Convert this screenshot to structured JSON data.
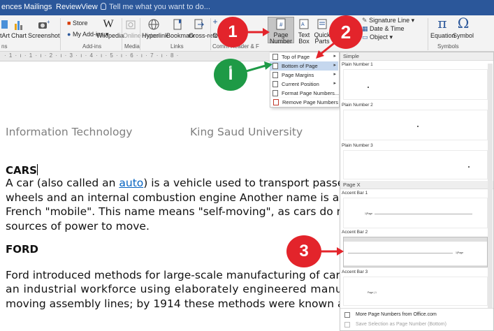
{
  "tabs": [
    {
      "label": "ences"
    },
    {
      "label": "Mailings"
    },
    {
      "label": "Review"
    },
    {
      "label": "View"
    }
  ],
  "tell_me": "Tell me what you want to do...",
  "ribbon": {
    "buttons": {
      "art": "tArt",
      "chart": "Chart",
      "screenshot": "Screenshot",
      "store": "Store",
      "my_addins": "My Add-ins",
      "wikipedia": "Wikipedia",
      "online_video": "Online Video",
      "hyperlink": "Hyperlink",
      "bookmark": "Bookmark",
      "cross_reference": "Cross-reference",
      "comment": "C",
      "page_number": "Page Number",
      "text_box": "Text Box",
      "quick_parts": "Quick Parts",
      "signature_line": "Signature Line",
      "date_time": "Date & Time",
      "object": "Object",
      "equation": "Equation",
      "symbol": "Symbol",
      "pi": "π",
      "omega": "Ω"
    },
    "groups": {
      "illustrations": "ns",
      "addins": "Add-ins",
      "media": "Media",
      "links": "Links",
      "comments": "Comm",
      "header_footer": "Header & F",
      "text": "t",
      "symbols": "Symbols"
    }
  },
  "ruler": "· 1 · ı · 1 · ı · 2 · ı · 3 · ı · 4 · ı · 5 · ı · 6 · ı · 7 · ı · 8 ·",
  "page_number_menu": {
    "items": [
      {
        "label": "Top of Page",
        "u": "T"
      },
      {
        "label": "Bottom of Page",
        "u": "B"
      },
      {
        "label": "Page Margins",
        "u": "P"
      },
      {
        "label": "Current Position",
        "u": "C"
      },
      {
        "label": "Format Page Numbers...",
        "u": "F"
      },
      {
        "label": "Remove Page Numbers",
        "u": "R"
      }
    ]
  },
  "gallery": {
    "section_simple": "Simple",
    "section_pagex": "Page X",
    "items": [
      {
        "title": "Plain Number 1"
      },
      {
        "title": "Plain Number 2"
      },
      {
        "title": "Plain Number 3"
      },
      {
        "title": "Accent Bar 1",
        "sample": "1|Page"
      },
      {
        "title": "Accent Bar 2",
        "sample": "1|Page"
      },
      {
        "title": "Accent Bar 3",
        "sample": "Page | 1"
      }
    ],
    "more": "More Page Numbers from Office.com",
    "save": "Save Selection as Page Number (Bottom)"
  },
  "document": {
    "header_left": "Information Technology",
    "header_right": "King Saud University",
    "heading1": "CARS",
    "p1_prefix": "A car (also called an ",
    "p1_link": "auto",
    "p1_suffix": ") is a vehicle used to transport passenge",
    "p1_line2": "wheels and an internal combustion engine Another name is automol",
    "p1_line3": "French \"mobile\". This name means \"self-moving\", as cars do not nee",
    "p1_line4": "sources of power to move.",
    "heading2": "FORD",
    "p2_line1": "Ford introduced methods for large-scale manufacturing of cars and l",
    "p2_line2": "an industrial workforce using elaborately engineered manufactur",
    "p2_line3": "moving assembly lines; by 1914 these methods were known around"
  },
  "callouts": {
    "c1": "1",
    "c2": "2",
    "c3": "3",
    "ca": "أ"
  },
  "colors": {
    "ribbon_blue": "#2b579a",
    "callout_red": "#e3242b",
    "callout_green": "#1e9a46",
    "menu_highlight": "#c5d7ee",
    "link_blue": "#0563c1"
  }
}
